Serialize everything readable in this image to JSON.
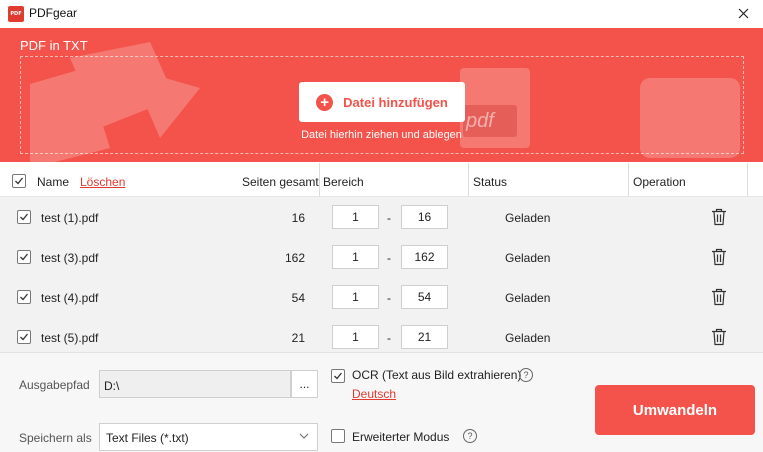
{
  "window": {
    "app_title": "PDFgear",
    "logo_text": "PDF"
  },
  "banner": {
    "title": "PDF in TXT",
    "add_button_label": "Datei hinzufügen",
    "drop_hint": "Datei hierhin ziehen und ablegen",
    "deco_text": "pdf"
  },
  "table": {
    "headers": {
      "name": "Name",
      "delete_all": "Löschen",
      "pages_total": "Seiten gesamt",
      "range": "Bereich",
      "status": "Status",
      "operation": "Operation"
    },
    "range_separator": "-",
    "rows": [
      {
        "name": "test (1).pdf",
        "pages": "16",
        "from": "1",
        "to": "16",
        "status": "Geladen"
      },
      {
        "name": "test (3).pdf",
        "pages": "162",
        "from": "1",
        "to": "162",
        "status": "Geladen"
      },
      {
        "name": "test (4).pdf",
        "pages": "54",
        "from": "1",
        "to": "54",
        "status": "Geladen"
      },
      {
        "name": "test (5).pdf",
        "pages": "21",
        "from": "1",
        "to": "21",
        "status": "Geladen"
      }
    ]
  },
  "footer": {
    "output_path_label": "Ausgabepfad",
    "output_path_value": "D:\\",
    "browse_label": "...",
    "save_as_label": "Speichern als",
    "save_as_value": "Text Files (*.txt)",
    "ocr_label": "OCR (Text aus Bild extrahieren)",
    "ocr_checked": true,
    "ocr_language": "Deutsch",
    "extended_mode_label": "Erweiterter Modus",
    "extended_mode_checked": false,
    "help_glyph": "?",
    "convert_label": "Umwandeln"
  },
  "colors": {
    "accent": "#f3534a",
    "link": "#e03b30",
    "row_bg": "#f2f2f2"
  }
}
